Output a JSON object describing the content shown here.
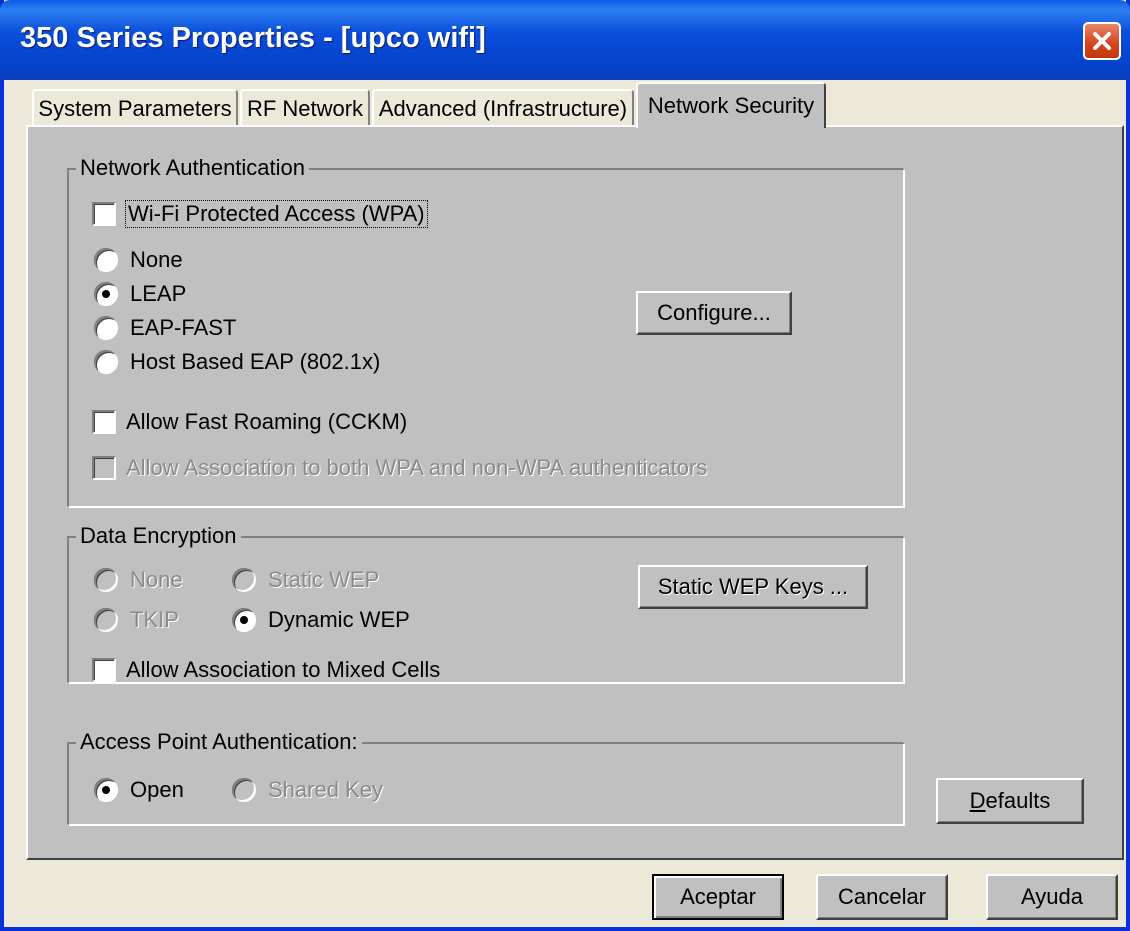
{
  "window": {
    "title": "350 Series Properties - [upco wifi]"
  },
  "tabs": [
    {
      "label": "System Parameters",
      "active": false
    },
    {
      "label": "RF Network",
      "active": false
    },
    {
      "label": "Advanced (Infrastructure)",
      "active": false
    },
    {
      "label": "Network Security",
      "active": true
    }
  ],
  "network_auth": {
    "legend": "Network Authentication",
    "wpa_label": "Wi-Fi Protected Access (WPA)",
    "wpa_checked": false,
    "options": [
      {
        "label": "None",
        "selected": false
      },
      {
        "label": "LEAP",
        "selected": true
      },
      {
        "label": "EAP-FAST",
        "selected": false
      },
      {
        "label": "Host Based EAP (802.1x)",
        "selected": false
      }
    ],
    "configure_label": "Configure...",
    "fast_roaming_label": "Allow Fast Roaming (CCKM)",
    "fast_roaming_checked": false,
    "mixed_auth_label": "Allow Association to both WPA and non-WPA authenticators",
    "mixed_auth_enabled": false
  },
  "data_encryption": {
    "legend": "Data Encryption",
    "none_label": "None",
    "static_wep_label": "Static WEP",
    "tkip_label": "TKIP",
    "dynamic_wep_label": "Dynamic WEP",
    "selected": "Dynamic WEP",
    "static_keys_label": "Static WEP Keys ...",
    "mixed_cells_label": "Allow Association to Mixed Cells",
    "mixed_cells_checked": false
  },
  "ap_auth": {
    "legend": "Access Point Authentication:",
    "open_label": "Open",
    "shared_key_label": "Shared Key",
    "selected": "Open"
  },
  "buttons": {
    "defaults_prefix": "D",
    "defaults_rest": "efaults",
    "ok": "Aceptar",
    "cancel": "Cancelar",
    "help": "Ayuda"
  },
  "colors": {
    "title_bar": "#0a4fdc",
    "panel_bg": "#c0c0c0",
    "window_bg": "#ece9d8",
    "close_red": "#d3431a"
  }
}
